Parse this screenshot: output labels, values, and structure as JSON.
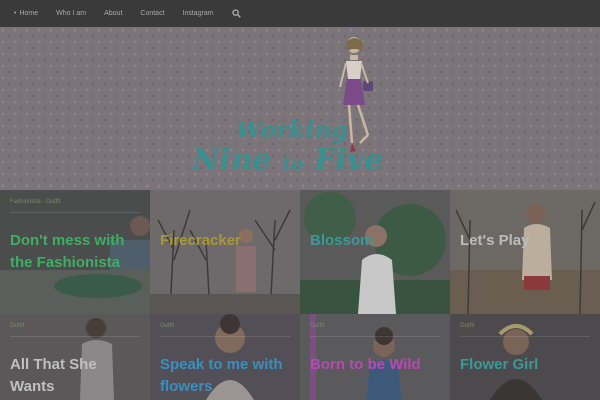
{
  "nav": {
    "items": [
      {
        "label": "Home",
        "active": true
      },
      {
        "label": "Who I am"
      },
      {
        "label": "About"
      },
      {
        "label": "Contact"
      },
      {
        "label": "Instagram"
      }
    ]
  },
  "logo": {
    "line1": "Working",
    "line2a": "Nine ",
    "line2b": "to",
    "line2c": " Five"
  },
  "posts": [
    {
      "meta": "Fashionista · Outfit",
      "title": "Don't mess with the Fashionista",
      "color": "#3fae62"
    },
    {
      "title": "Firecracker",
      "color": "#a89a33"
    },
    {
      "title": "Blossom",
      "color": "#3a9a9a"
    },
    {
      "title": "Let's Play",
      "color": "#bcbcbc"
    },
    {
      "meta": "Outfit",
      "title": "All That She Wants",
      "color": "#c0c0c0"
    },
    {
      "meta": "Outfit",
      "title": "Speak to me with flowers",
      "color": "#3a8fbf"
    },
    {
      "meta": "Outfit",
      "title": "Born to be Wild",
      "color": "#b64ab0"
    },
    {
      "meta": "Outfit",
      "title": "Flower Girl",
      "color": "#3a9a9a"
    }
  ],
  "colors": {
    "nav_bg": "#3a3a3a",
    "hero_bg": "#7b7479",
    "logo": "#3a8f8f"
  }
}
